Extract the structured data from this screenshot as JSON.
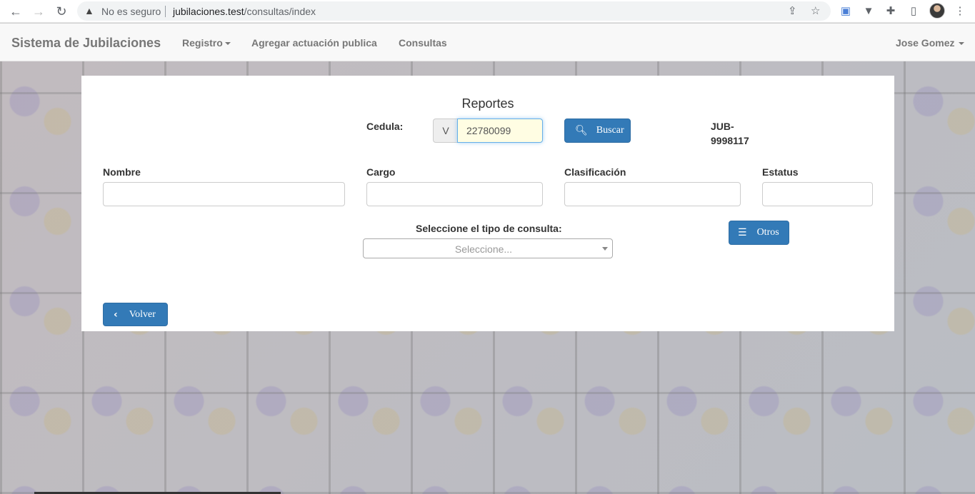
{
  "browser": {
    "security_label": "No es seguro",
    "url_host": "jubilaciones.test",
    "url_path": "/consultas/index"
  },
  "navbar": {
    "brand": "Sistema de Jubilaciones",
    "registro": "Registro",
    "agregar": "Agregar actuación publica",
    "consultas": "Consultas",
    "user": "Jose Gomez"
  },
  "form": {
    "title": "Reportes",
    "cedula_label": "Cedula:",
    "cedula_prefix": "V",
    "cedula_value": "22780099",
    "buscar_label": "Buscar",
    "jub_code": "JUB-9998117",
    "nombre_label": "Nombre",
    "nombre_value": "",
    "cargo_label": "Cargo",
    "cargo_value": "",
    "clasificacion_label": "Clasificación",
    "clasificacion_value": "",
    "estatus_label": "Estatus",
    "estatus_value": "",
    "tipo_label": "Seleccione el tipo de consulta:",
    "tipo_placeholder": "Seleccione...",
    "otros_label": "Otros",
    "volver_label": "Volver"
  }
}
